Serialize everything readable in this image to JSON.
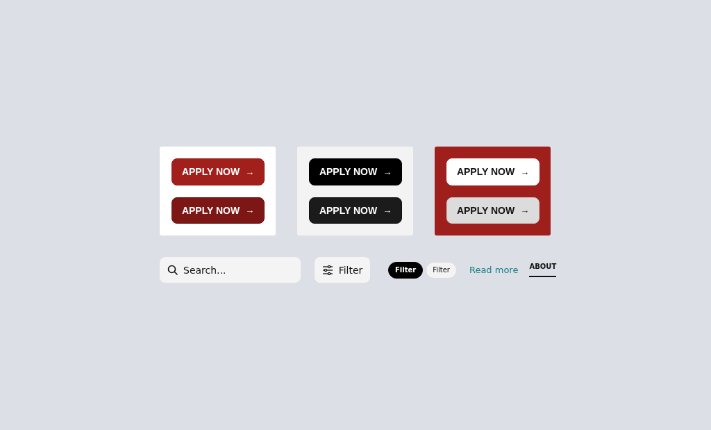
{
  "panels": [
    {
      "kind": "white",
      "buttons": [
        {
          "label": "APPLY NOW",
          "icon": "→",
          "kind": "red"
        },
        {
          "label": "APPLY NOW",
          "icon": "→",
          "kind": "darkred"
        }
      ]
    },
    {
      "kind": "gray",
      "buttons": [
        {
          "label": "APPLY NOW",
          "icon": "→",
          "kind": "black"
        },
        {
          "label": "APPLY NOW",
          "icon": "→",
          "kind": "charcoal"
        }
      ]
    },
    {
      "kind": "red",
      "buttons": [
        {
          "label": "APPLY NOW",
          "icon": "→",
          "kind": "white"
        },
        {
          "label": "APPLY NOW",
          "icon": "→",
          "kind": "lightgray"
        }
      ]
    }
  ],
  "search": {
    "placeholder": "Search..."
  },
  "filter_button": {
    "label": "Filter"
  },
  "pills": [
    {
      "label": "Filter",
      "selected": true
    },
    {
      "label": "Filter",
      "selected": false
    }
  ],
  "link": {
    "label": "Read more"
  },
  "tab": {
    "label": "ABOUT",
    "selected": true
  }
}
